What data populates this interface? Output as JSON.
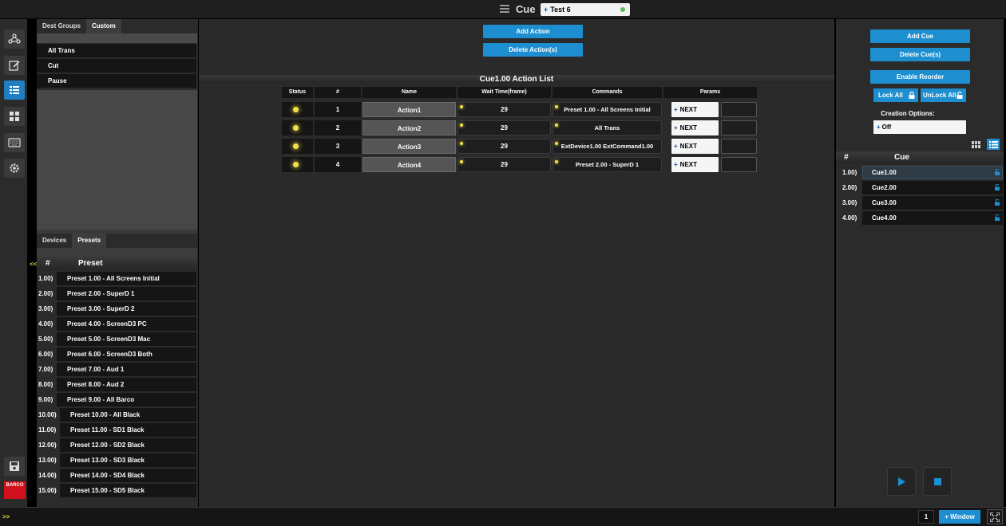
{
  "header": {
    "title": "Cue",
    "test_selector": "Test 6",
    "test_plus": "+"
  },
  "rail": {
    "icons": [
      "network-icon",
      "edit-icon",
      "list-icon",
      "grid-icon",
      "keyboard-icon",
      "gear-icon"
    ],
    "save_icon": "save-icon",
    "brand": "BARCO"
  },
  "left_panel": {
    "tabs": [
      "Dest Groups",
      "Custom"
    ],
    "custom_items": [
      "All Trans",
      "Cut",
      "Pause"
    ],
    "preset_tabs": [
      "Devices",
      "Presets"
    ],
    "preset_header": {
      "num": "#",
      "name": "Preset"
    },
    "collapse": "<<",
    "presets": [
      {
        "num": "1.00)",
        "name": "Preset 1.00 - All Screens Initial"
      },
      {
        "num": "2.00)",
        "name": "Preset 2.00 - SuperD 1"
      },
      {
        "num": "3.00)",
        "name": "Preset 3.00 - SuperD 2"
      },
      {
        "num": "4.00)",
        "name": "Preset 4.00 - ScreenD3 PC"
      },
      {
        "num": "5.00)",
        "name": "Preset 5.00 - ScreenD3 Mac"
      },
      {
        "num": "6.00)",
        "name": "Preset 6.00 - ScreenD3 Both"
      },
      {
        "num": "7.00)",
        "name": "Preset 7.00 - Aud 1"
      },
      {
        "num": "8.00)",
        "name": "Preset 8.00 - Aud 2"
      },
      {
        "num": "9.00)",
        "name": "Preset 9.00 - All Barco"
      },
      {
        "num": "10.00)",
        "name": "Preset 10.00 - All Black"
      },
      {
        "num": "11.00)",
        "name": "Preset 11.00 - SD1 Black"
      },
      {
        "num": "12.00)",
        "name": "Preset 12.00 - SD2 Black"
      },
      {
        "num": "13.00)",
        "name": "Preset 13.00 - SD3 Black"
      },
      {
        "num": "14.00)",
        "name": "Preset 14.00 - SD4 Black"
      },
      {
        "num": "15.00)",
        "name": "Preset 15.00 - SD5 Black"
      }
    ]
  },
  "center": {
    "add_action": "Add Action",
    "delete_action": "Delete Action(s)",
    "list_title": "Cue1.00 Action List",
    "columns": [
      "Status",
      "#",
      "Name",
      "Wait Time(frame)",
      "Commands",
      "Params"
    ],
    "next_label": "NEXT",
    "next_plus": "+",
    "actions": [
      {
        "num": "1",
        "name": "Action1",
        "wait": "29",
        "command": "Preset 1.00 - All Screens Initial",
        "has_next": true
      },
      {
        "num": "2",
        "name": "Action2",
        "wait": "29",
        "command": "All Trans",
        "has_next": true
      },
      {
        "num": "3",
        "name": "Action3",
        "wait": "29",
        "command": "ExtDevice1.00 ExtCommand1.00",
        "has_next": true
      },
      {
        "num": "4",
        "name": "Action4",
        "wait": "29",
        "command": "Preset 2.00 - SuperD 1",
        "has_next": true
      }
    ]
  },
  "right_panel": {
    "add_cue": "Add Cue",
    "delete_cue": "Delete Cue(s)",
    "enable_reorder": "Enable Reorder",
    "lock_all": "Lock All",
    "unlock_all": "UnLock All",
    "creation_label": "Creation Options:",
    "creation_value": "Off",
    "creation_plus": "+",
    "cue_header": {
      "num": "#",
      "name": "Cue"
    },
    "cues": [
      {
        "num": "1.00)",
        "name": "Cue1.00",
        "selected": true
      },
      {
        "num": "2.00)",
        "name": "Cue2.00",
        "selected": false
      },
      {
        "num": "3.00)",
        "name": "Cue3.00",
        "selected": false
      },
      {
        "num": "4.00)",
        "name": "Cue4.00",
        "selected": false
      }
    ]
  },
  "bottom": {
    "expand": ">>",
    "window_count": "1",
    "add_window": "+ Window"
  },
  "colors": {
    "accent": "#1d8fd1",
    "led": "#f2e24a",
    "brand": "#d0101a"
  }
}
